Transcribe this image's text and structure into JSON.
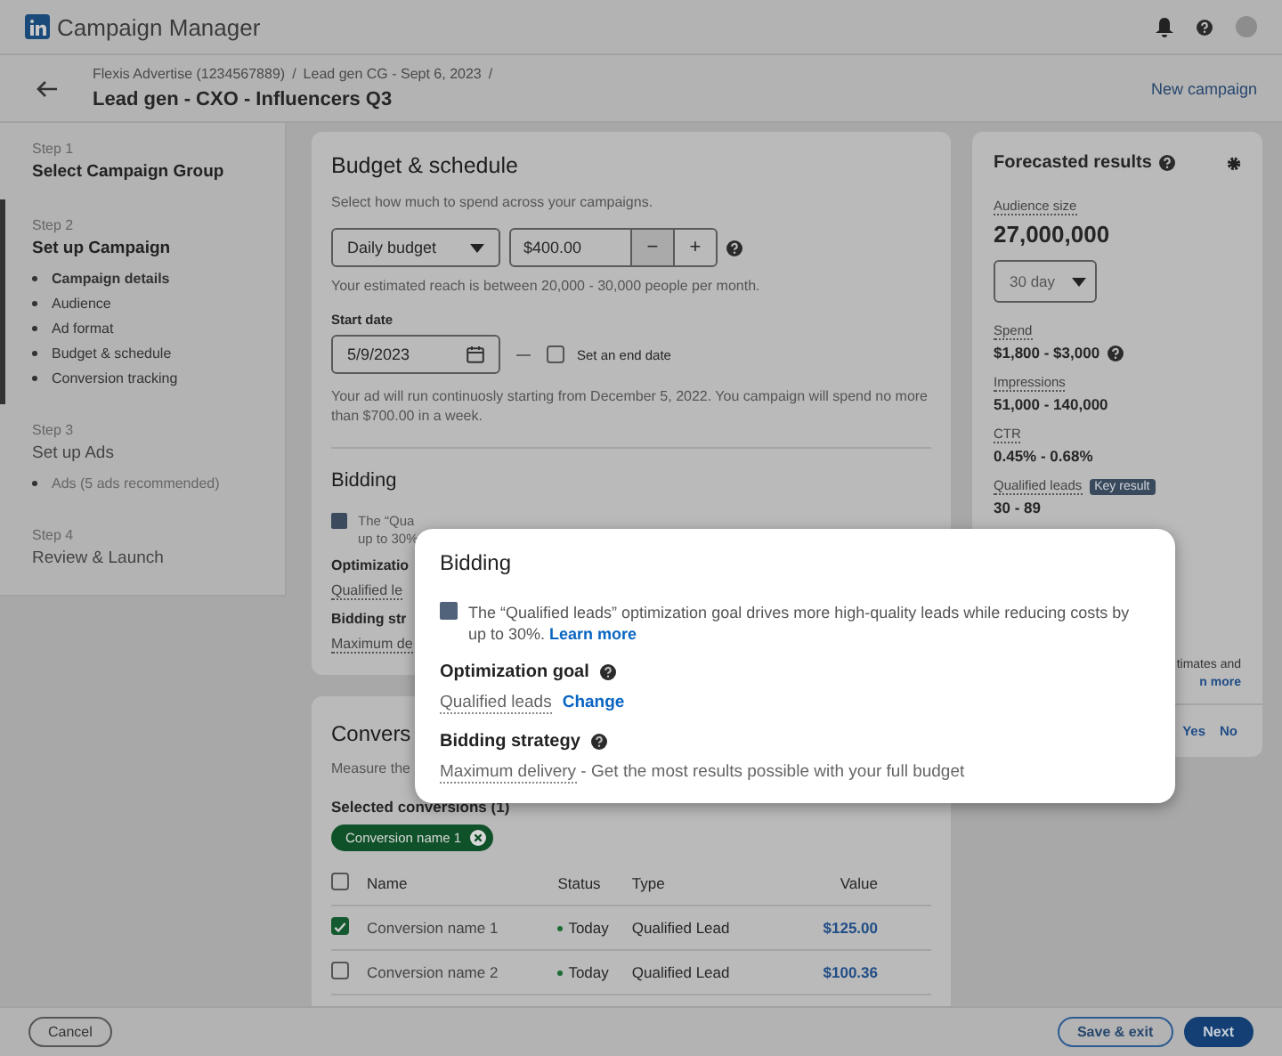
{
  "app": {
    "name": "Campaign Manager"
  },
  "header": {
    "breadcrumbs": [
      "Flexis Advertise (1234567889)",
      "Lead gen CG - Sept 6, 2023"
    ],
    "separator": "/",
    "title": "Lead gen - CXO - Influencers Q3",
    "action": "New campaign"
  },
  "steps": [
    {
      "step": "Step 1",
      "title": "Select Campaign Group",
      "selected": false,
      "completed": true
    },
    {
      "step": "Step 2",
      "title": "Set up Campaign",
      "selected": true,
      "completed": true,
      "items": [
        {
          "label": "Campaign details",
          "selected": true
        },
        {
          "label": "Audience",
          "selected": false
        },
        {
          "label": "Ad format",
          "selected": false
        },
        {
          "label": "Budget & schedule",
          "selected": false
        },
        {
          "label": "Conversion tracking",
          "selected": false
        }
      ]
    },
    {
      "step": "Step 3",
      "title": "Set up Ads",
      "selected": false,
      "completed": false,
      "items": [
        {
          "label": "Ads (5 ads recommended)",
          "selected": false
        }
      ]
    },
    {
      "step": "Step 4",
      "title": "Review & Launch",
      "selected": false,
      "completed": false
    }
  ],
  "budget": {
    "title": "Budget & schedule",
    "subtitle": "Select how much to spend across your campaigns.",
    "budget_type": "Daily budget",
    "amount": "$400.00",
    "minus": "−",
    "plus": "+",
    "reach_note": "Your estimated reach is between 20,000 - 30,000 people per month.",
    "start_label": "Start date",
    "start_date": "5/9/2023",
    "end_date": {
      "label": "Set an end date",
      "checked": false
    },
    "schedule_note": "Your ad will run continuosly starting from December 5, 2022. You campaign will spend no more than $700.00 in a week."
  },
  "bidding": {
    "title": "Bidding",
    "info_lines": [
      "The “Qua",
      "up to 30%"
    ],
    "optimization_label": "Optimizatio",
    "goal_value": "Qualified le",
    "strategy_label": "Bidding str",
    "strategy_value": "Maximum de"
  },
  "conversion": {
    "title": "Convers",
    "description": "Measure the",
    "selected_label": "Selected conversions (1)",
    "chips": [
      "Conversion name 1"
    ],
    "header_checked": false,
    "columns": [
      "Name",
      "Status",
      "Type",
      "Value"
    ],
    "rows": [
      {
        "checked": true,
        "name": "Conversion name 1",
        "status": "Today",
        "type": "Qualified Lead",
        "value": "$125.00"
      },
      {
        "checked": false,
        "name": "Conversion name 2",
        "status": "Today",
        "type": "Qualified Lead",
        "value": "$100.36"
      }
    ]
  },
  "forecast": {
    "title": "Forecasted results",
    "audience_label": "Audience size",
    "audience_value": "27,000,000",
    "period": "30 day",
    "metrics": [
      {
        "label": "Spend",
        "value": "$1,800 - $3,000",
        "help": true
      },
      {
        "label": "Impressions",
        "value": "51,000 - 140,000",
        "help": false
      },
      {
        "label": "CTR",
        "value": "0.45% - 0.68%",
        "help": false
      },
      {
        "label": "Qualified leads",
        "badge": "Key result",
        "value": "30 - 89",
        "help": false
      }
    ],
    "note_lines": [
      "timates and",
      "n more"
    ],
    "feedback": [
      "Yes",
      "No"
    ]
  },
  "modal": {
    "title": "Bidding",
    "info": "The “Qualified leads” optimization goal drives more high-quality leads while reducing costs by up to 30%.",
    "info_link": "Learn more",
    "goal_label": "Optimization goal",
    "goal_value": "Qualified leads",
    "goal_action": "Change",
    "strategy_label": "Bidding strategy",
    "strategy_value": "Maximum delivery",
    "strategy_desc": " - Get the most results possible with your full budget"
  },
  "footer": {
    "cancel": "Cancel",
    "save": "Save & exit",
    "next": "Next"
  }
}
